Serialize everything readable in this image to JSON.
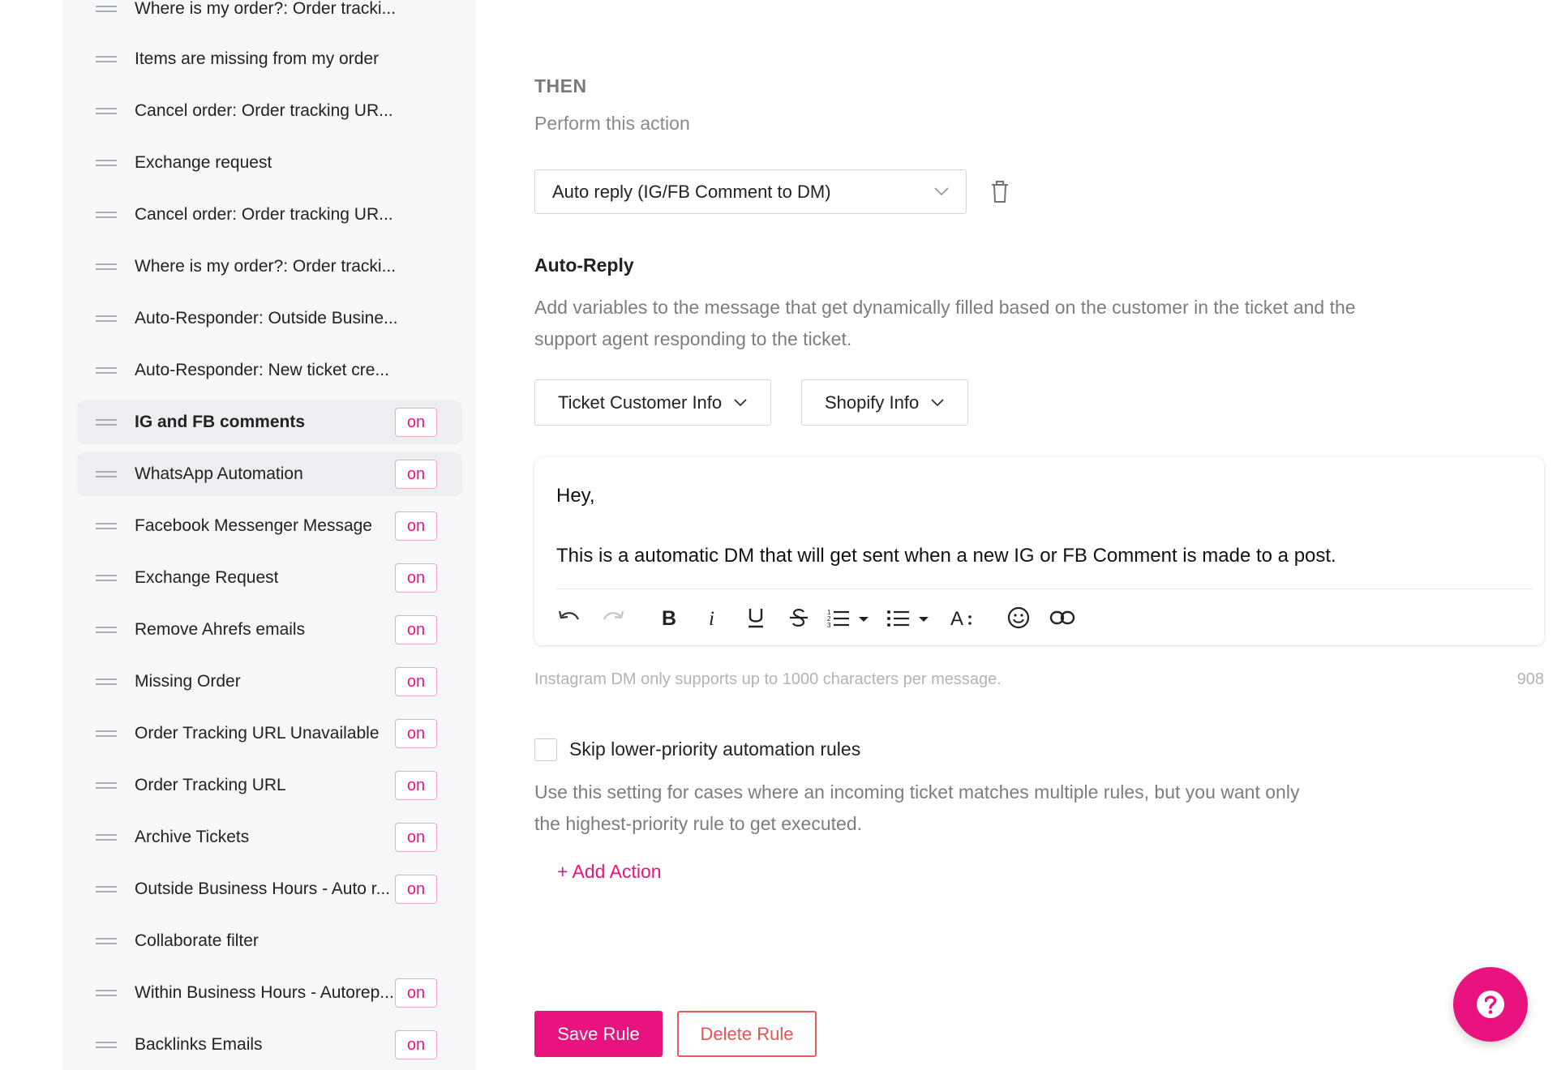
{
  "sidebar": {
    "items": [
      {
        "label": "Where is my order?: Order tracki...",
        "on": false,
        "active": false
      },
      {
        "label": "Items are missing from my order",
        "on": false,
        "active": false
      },
      {
        "label": "Cancel order: Order tracking UR...",
        "on": false,
        "active": false
      },
      {
        "label": "Exchange request",
        "on": false,
        "active": false
      },
      {
        "label": "Cancel order: Order tracking UR...",
        "on": false,
        "active": false
      },
      {
        "label": "Where is my order?: Order tracki...",
        "on": false,
        "active": false
      },
      {
        "label": "Auto-Responder: Outside Busine...",
        "on": false,
        "active": false
      },
      {
        "label": "Auto-Responder: New ticket cre...",
        "on": false,
        "active": false
      },
      {
        "label": "IG and FB comments",
        "on": true,
        "active": true,
        "bold": true
      },
      {
        "label": "WhatsApp Automation",
        "on": true,
        "active": true
      },
      {
        "label": "Facebook Messenger Message",
        "on": true,
        "active": false
      },
      {
        "label": "Exchange Request",
        "on": true,
        "active": false
      },
      {
        "label": "Remove Ahrefs emails",
        "on": true,
        "active": false
      },
      {
        "label": "Missing Order",
        "on": true,
        "active": false
      },
      {
        "label": "Order Tracking URL Unavailable",
        "on": true,
        "active": false
      },
      {
        "label": "Order Tracking URL",
        "on": true,
        "active": false
      },
      {
        "label": "Archive Tickets",
        "on": true,
        "active": false
      },
      {
        "label": "Outside Business Hours - Auto r...",
        "on": true,
        "active": false
      },
      {
        "label": "Collaborate filter",
        "on": false,
        "active": false
      },
      {
        "label": "Within Business Hours - Autorep...",
        "on": true,
        "active": false
      },
      {
        "label": "Backlinks Emails",
        "on": true,
        "active": false
      }
    ],
    "on_label": "on"
  },
  "then": {
    "title": "THEN",
    "subtitle": "Perform this action",
    "action_select": "Auto reply (IG/FB Comment to DM)"
  },
  "auto_reply": {
    "title": "Auto-Reply",
    "description": "Add variables to the message that get dynamically filled based on the customer in the ticket and the support agent responding to the ticket.",
    "variable_buttons": [
      "Ticket Customer Info",
      "Shopify Info"
    ],
    "message_line1": "Hey,",
    "message_line2": "This is a automatic DM that will get sent when a new IG or FB Comment is made to a post.",
    "limit_note": "Instagram DM only supports up to 1000 characters per message.",
    "char_count": "908"
  },
  "skip": {
    "label": "Skip lower-priority automation rules",
    "description": "Use this setting for cases where an incoming ticket matches multiple rules, but you want only the highest-priority rule to get executed.",
    "checked": false
  },
  "add_action": "+ Add Action",
  "buttons": {
    "save": "Save Rule",
    "delete": "Delete Rule"
  },
  "colors": {
    "accent": "#e8137f",
    "danger": "#e35353"
  }
}
